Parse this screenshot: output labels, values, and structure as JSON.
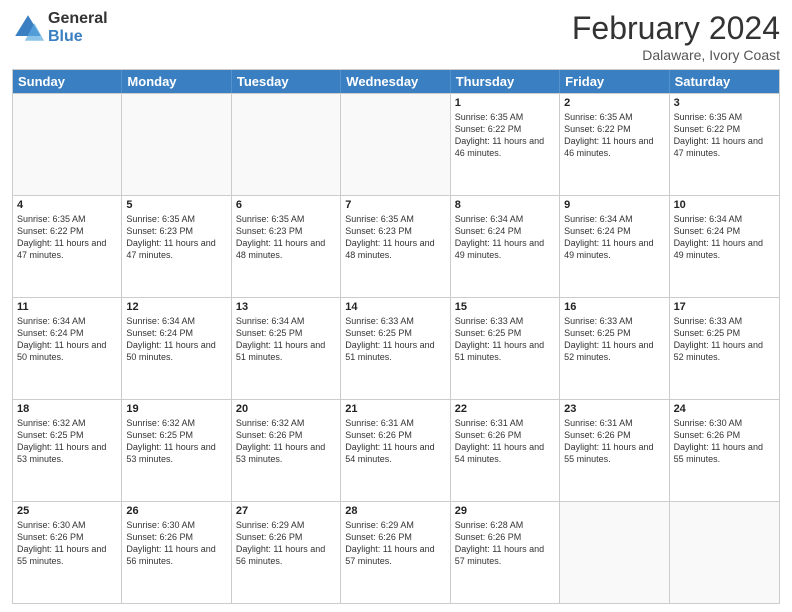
{
  "logo": {
    "general": "General",
    "blue": "Blue"
  },
  "header": {
    "month": "February 2024",
    "location": "Dalaware, Ivory Coast"
  },
  "days": [
    "Sunday",
    "Monday",
    "Tuesday",
    "Wednesday",
    "Thursday",
    "Friday",
    "Saturday"
  ],
  "rows": [
    [
      {
        "day": "",
        "info": ""
      },
      {
        "day": "",
        "info": ""
      },
      {
        "day": "",
        "info": ""
      },
      {
        "day": "",
        "info": ""
      },
      {
        "day": "1",
        "info": "Sunrise: 6:35 AM\nSunset: 6:22 PM\nDaylight: 11 hours and 46 minutes."
      },
      {
        "day": "2",
        "info": "Sunrise: 6:35 AM\nSunset: 6:22 PM\nDaylight: 11 hours and 46 minutes."
      },
      {
        "day": "3",
        "info": "Sunrise: 6:35 AM\nSunset: 6:22 PM\nDaylight: 11 hours and 47 minutes."
      }
    ],
    [
      {
        "day": "4",
        "info": "Sunrise: 6:35 AM\nSunset: 6:22 PM\nDaylight: 11 hours and 47 minutes."
      },
      {
        "day": "5",
        "info": "Sunrise: 6:35 AM\nSunset: 6:23 PM\nDaylight: 11 hours and 47 minutes."
      },
      {
        "day": "6",
        "info": "Sunrise: 6:35 AM\nSunset: 6:23 PM\nDaylight: 11 hours and 48 minutes."
      },
      {
        "day": "7",
        "info": "Sunrise: 6:35 AM\nSunset: 6:23 PM\nDaylight: 11 hours and 48 minutes."
      },
      {
        "day": "8",
        "info": "Sunrise: 6:34 AM\nSunset: 6:24 PM\nDaylight: 11 hours and 49 minutes."
      },
      {
        "day": "9",
        "info": "Sunrise: 6:34 AM\nSunset: 6:24 PM\nDaylight: 11 hours and 49 minutes."
      },
      {
        "day": "10",
        "info": "Sunrise: 6:34 AM\nSunset: 6:24 PM\nDaylight: 11 hours and 49 minutes."
      }
    ],
    [
      {
        "day": "11",
        "info": "Sunrise: 6:34 AM\nSunset: 6:24 PM\nDaylight: 11 hours and 50 minutes."
      },
      {
        "day": "12",
        "info": "Sunrise: 6:34 AM\nSunset: 6:24 PM\nDaylight: 11 hours and 50 minutes."
      },
      {
        "day": "13",
        "info": "Sunrise: 6:34 AM\nSunset: 6:25 PM\nDaylight: 11 hours and 51 minutes."
      },
      {
        "day": "14",
        "info": "Sunrise: 6:33 AM\nSunset: 6:25 PM\nDaylight: 11 hours and 51 minutes."
      },
      {
        "day": "15",
        "info": "Sunrise: 6:33 AM\nSunset: 6:25 PM\nDaylight: 11 hours and 51 minutes."
      },
      {
        "day": "16",
        "info": "Sunrise: 6:33 AM\nSunset: 6:25 PM\nDaylight: 11 hours and 52 minutes."
      },
      {
        "day": "17",
        "info": "Sunrise: 6:33 AM\nSunset: 6:25 PM\nDaylight: 11 hours and 52 minutes."
      }
    ],
    [
      {
        "day": "18",
        "info": "Sunrise: 6:32 AM\nSunset: 6:25 PM\nDaylight: 11 hours and 53 minutes."
      },
      {
        "day": "19",
        "info": "Sunrise: 6:32 AM\nSunset: 6:25 PM\nDaylight: 11 hours and 53 minutes."
      },
      {
        "day": "20",
        "info": "Sunrise: 6:32 AM\nSunset: 6:26 PM\nDaylight: 11 hours and 53 minutes."
      },
      {
        "day": "21",
        "info": "Sunrise: 6:31 AM\nSunset: 6:26 PM\nDaylight: 11 hours and 54 minutes."
      },
      {
        "day": "22",
        "info": "Sunrise: 6:31 AM\nSunset: 6:26 PM\nDaylight: 11 hours and 54 minutes."
      },
      {
        "day": "23",
        "info": "Sunrise: 6:31 AM\nSunset: 6:26 PM\nDaylight: 11 hours and 55 minutes."
      },
      {
        "day": "24",
        "info": "Sunrise: 6:30 AM\nSunset: 6:26 PM\nDaylight: 11 hours and 55 minutes."
      }
    ],
    [
      {
        "day": "25",
        "info": "Sunrise: 6:30 AM\nSunset: 6:26 PM\nDaylight: 11 hours and 55 minutes."
      },
      {
        "day": "26",
        "info": "Sunrise: 6:30 AM\nSunset: 6:26 PM\nDaylight: 11 hours and 56 minutes."
      },
      {
        "day": "27",
        "info": "Sunrise: 6:29 AM\nSunset: 6:26 PM\nDaylight: 11 hours and 56 minutes."
      },
      {
        "day": "28",
        "info": "Sunrise: 6:29 AM\nSunset: 6:26 PM\nDaylight: 11 hours and 57 minutes."
      },
      {
        "day": "29",
        "info": "Sunrise: 6:28 AM\nSunset: 6:26 PM\nDaylight: 11 hours and 57 minutes."
      },
      {
        "day": "",
        "info": ""
      },
      {
        "day": "",
        "info": ""
      }
    ]
  ]
}
